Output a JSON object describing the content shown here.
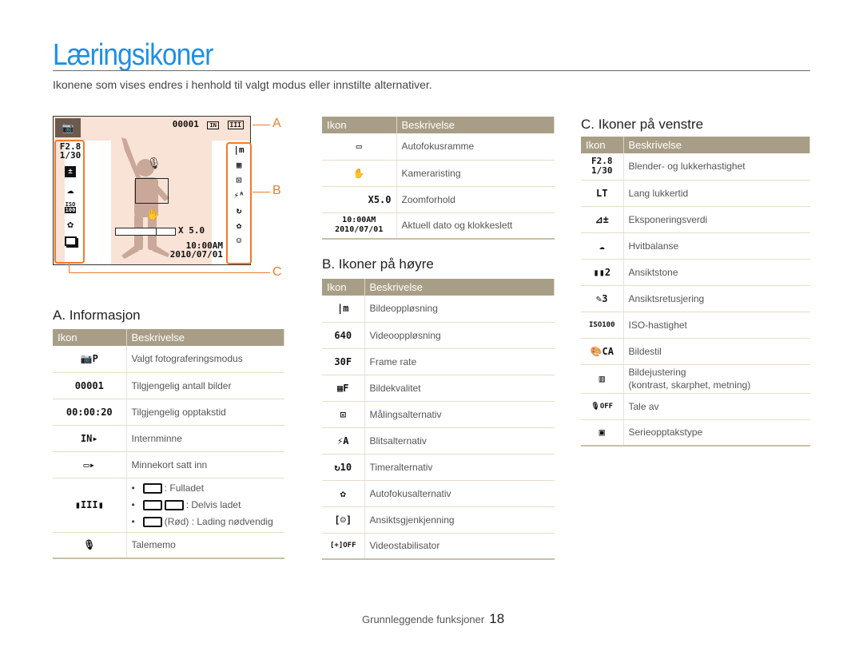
{
  "page": {
    "title": "Læringsikoner",
    "intro": "Ikonene som vises endres i henhold til valgt modus eller innstilte alternativer.",
    "footer_section": "Grunnleggende funksjoner",
    "footer_page": "18"
  },
  "screen": {
    "mode_icon": "camera-program-icon",
    "shots_remaining": "00001",
    "memory_icon": "IN",
    "aperture": "F2.8",
    "shutter": "1/30",
    "zoom": "X 5.0",
    "time": "10:00AM",
    "date": "2010/07/01",
    "labels": {
      "a": "A",
      "b": "B",
      "c": "C"
    },
    "left_icons": [
      "ev-icon",
      "cloudy-wb-icon",
      "iso-icon",
      "photo-style-icon",
      "burst-icon"
    ],
    "right_icons": [
      "resolution-icon",
      "quality-icon",
      "metering-icon",
      "flash-auto-icon",
      "timer-icon",
      "macro-icon",
      "face-detect-icon"
    ]
  },
  "colors": {
    "title": "#1e8fe6",
    "header": "#a89e87",
    "accent": "#f07a2a",
    "screen_bg": "#f9e3d6"
  },
  "sectionA": {
    "title": "A. Informasjon",
    "headers": [
      "Ikon",
      "Beskrivelse"
    ],
    "rows": [
      {
        "icon": "📷P",
        "desc": "Valgt fotograferingsmodus"
      },
      {
        "icon": "00001",
        "desc": "Tilgjengelig antall bilder"
      },
      {
        "icon": "00:00:20",
        "desc": "Tilgjengelig opptakstid"
      },
      {
        "icon": "IN▸",
        "desc": "Internminne"
      },
      {
        "icon": "▭▸",
        "desc": "Minnekort satt inn"
      },
      {
        "icon": "▮III▮",
        "desc": "",
        "bullets": [
          ": Fulladet",
          ": Delvis ladet",
          "(Rød) : Lading nødvendig"
        ]
      },
      {
        "icon": "🎙",
        "desc": "Talememo"
      }
    ]
  },
  "sectionTop": {
    "headers": [
      "Ikon",
      "Beskrivelse"
    ],
    "rows": [
      {
        "icon": "▭",
        "desc": "Autofokusramme"
      },
      {
        "icon": "✋",
        "desc": "Kameraristing"
      },
      {
        "icon": "X5.0",
        "desc": "Zoomforhold"
      },
      {
        "icon": "10:00AM\n2010/07/01",
        "icon_line1": "10:00AM",
        "icon_line2": "2010/07/01",
        "desc": "Aktuell dato og klokkeslett"
      }
    ]
  },
  "sectionB": {
    "title": "B. Ikoner på høyre",
    "headers": [
      "Ikon",
      "Beskrivelse"
    ],
    "rows": [
      {
        "icon": "|m",
        "desc": "Bildeoppløsning"
      },
      {
        "icon": "640",
        "desc": "Videooppløsning"
      },
      {
        "icon": "30F",
        "desc": "Frame rate"
      },
      {
        "icon": "▦F",
        "desc": "Bildekvalitet"
      },
      {
        "icon": "⊡",
        "desc": "Målingsalternativ"
      },
      {
        "icon": "⚡A",
        "desc": "Blitsalternativ"
      },
      {
        "icon": "↻10",
        "desc": "Timeralternativ"
      },
      {
        "icon": "✿",
        "desc": "Autofokusalternativ"
      },
      {
        "icon": "[☺]",
        "desc": "Ansiktsgjenkjenning"
      },
      {
        "icon": "[+]OFF",
        "desc": "Videostabilisator"
      }
    ]
  },
  "sectionC": {
    "title": "C. Ikoner på venstre",
    "headers": [
      "Ikon",
      "Beskrivelse"
    ],
    "rows": [
      {
        "icon_line1": "F2.8",
        "icon_line2": "1/30",
        "desc": "Blender- og lukkerhastighet"
      },
      {
        "icon": "LT",
        "desc": "Lang lukkertid"
      },
      {
        "icon": "⊿±",
        "desc": "Eksponeringsverdi"
      },
      {
        "icon": "☁",
        "desc": "Hvitbalanse"
      },
      {
        "icon": "▮▮2",
        "desc": "Ansiktstone"
      },
      {
        "icon": "✎3",
        "desc": "Ansiktsretusjering"
      },
      {
        "icon": "ISO100",
        "desc": "ISO-hastighet"
      },
      {
        "icon": "🎨CA",
        "desc": "Bildestil"
      },
      {
        "icon": "▥",
        "desc": "Bildejustering",
        "desc2": "(kontrast, skarphet, metning)"
      },
      {
        "icon": "🎙OFF",
        "desc": "Tale av"
      },
      {
        "icon": "▣",
        "desc": "Serieopptakstype"
      }
    ]
  }
}
